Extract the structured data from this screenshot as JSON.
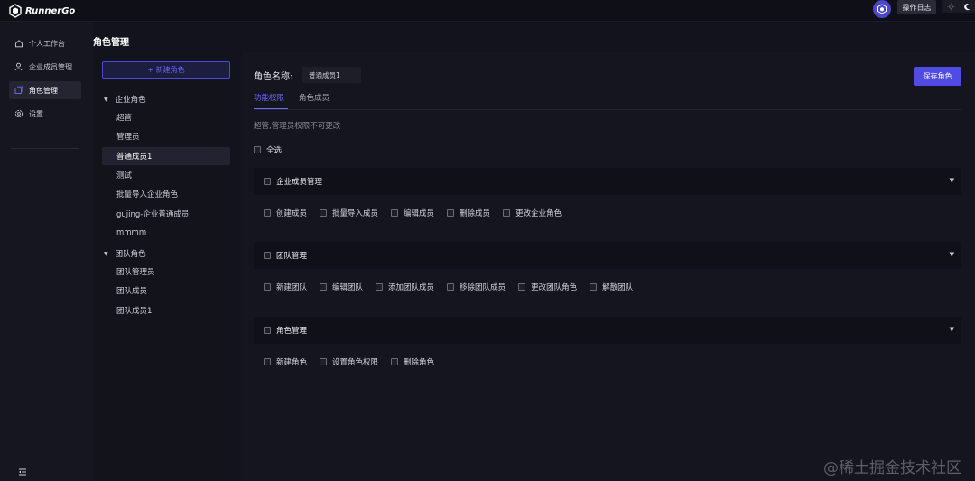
{
  "app": {
    "logo_text": "RunnerGo"
  },
  "header": {
    "oplog_label": "操作日志"
  },
  "nav": {
    "items": [
      {
        "label": "个人工作台",
        "icon": "home-icon",
        "active": false
      },
      {
        "label": "企业成员管理",
        "icon": "user-icon",
        "active": false
      },
      {
        "label": "角色管理",
        "icon": "role-icon",
        "active": true
      },
      {
        "label": "设置",
        "icon": "gear-icon",
        "active": false
      }
    ]
  },
  "page": {
    "title": "角色管理"
  },
  "roles": {
    "new_button": "+ 新建角色",
    "groups": [
      {
        "label": "企业角色",
        "items": [
          "超管",
          "管理员",
          "普通成员1",
          "测试",
          "批量导入企业角色",
          "gujing-企业普通成员",
          "mmmm"
        ]
      },
      {
        "label": "团队角色",
        "items": [
          "团队管理员",
          "团队成员",
          "团队成员1"
        ]
      }
    ],
    "selected": "普通成员1"
  },
  "editor": {
    "role_name_label": "角色名称:",
    "role_name_value": "普通成员1",
    "save_label": "保存角色",
    "tabs": [
      {
        "label": "功能权限",
        "active": true
      },
      {
        "label": "角色成员",
        "active": false
      }
    ],
    "hint": "超管,管理员权限不可更改",
    "select_all": "全选",
    "sections": [
      {
        "title": "企业成员管理",
        "items": [
          "创建成员",
          "批量导入成员",
          "编辑成员",
          "删除成员",
          "更改企业角色"
        ]
      },
      {
        "title": "团队管理",
        "items": [
          "新建团队",
          "编辑团队",
          "添加团队成员",
          "移除团队成员",
          "更改团队角色",
          "解散团队"
        ]
      },
      {
        "title": "角色管理",
        "items": [
          "新建角色",
          "设置角色权限",
          "删除角色"
        ]
      }
    ]
  },
  "watermark": "@稀土掘金技术社区",
  "colors": {
    "accent": "#4f4be3",
    "accent_text": "#6e6aff",
    "bg": "#13131d"
  }
}
